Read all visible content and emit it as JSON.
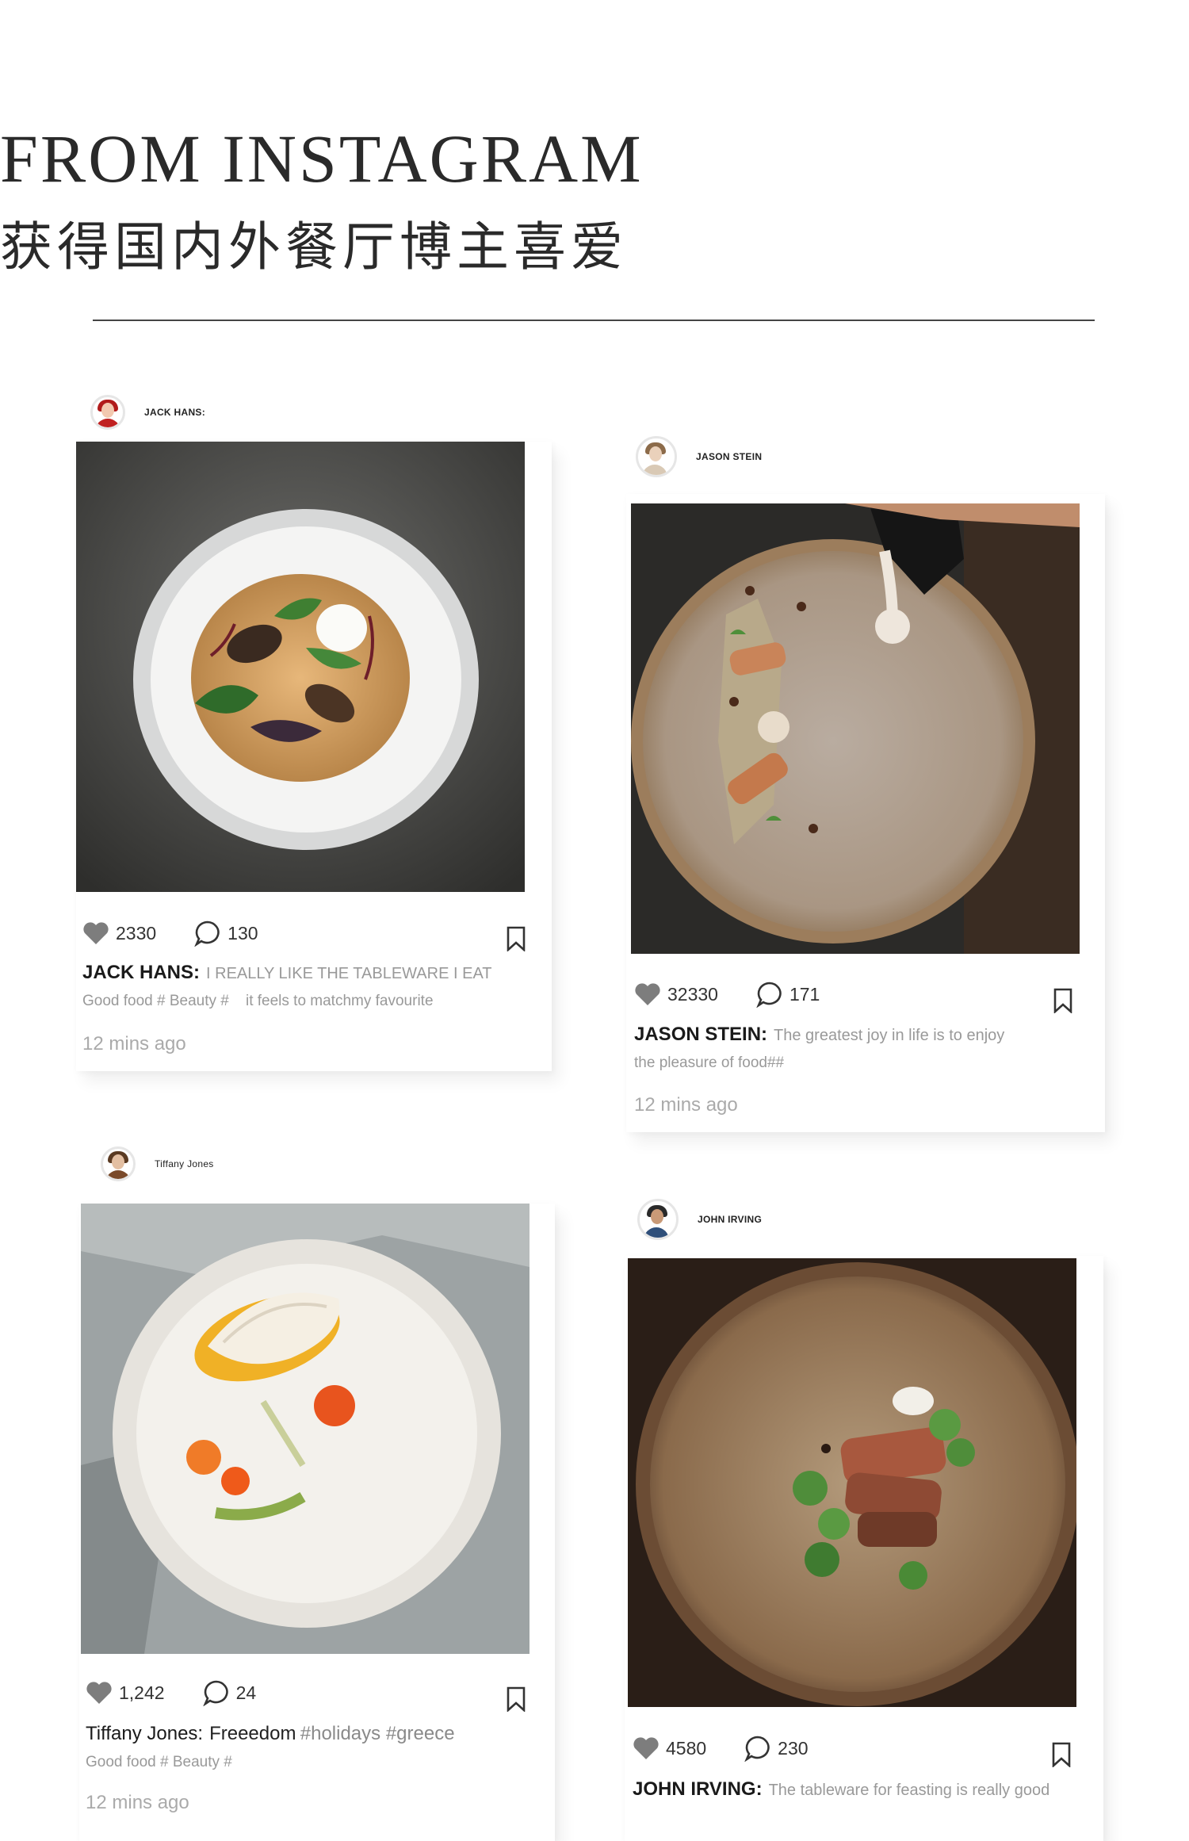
{
  "header": {
    "title_en": "FROM INSTAGRAM",
    "title_cn": "获得国内外餐厅博主喜爱"
  },
  "posts": [
    {
      "username": "JACK HANS:",
      "likes": "2330",
      "comments": "130",
      "caption_name": "JACK HANS:",
      "caption_text": "I REALLY LIKE THE TABLEWARE I EAT",
      "caption_line2": "Good food # Beauty #    it feels to matchmy favourite",
      "time": "12 mins ago"
    },
    {
      "username": "JASON STEIN",
      "likes": "32330",
      "comments": "171",
      "caption_name": "JASON STEIN:",
      "caption_text": "The greatest joy in life is to enjoy",
      "caption_line2": "the pleasure of food##",
      "time": "12 mins ago"
    },
    {
      "username": "Tiffany Jones",
      "likes": "1,242",
      "comments": "24",
      "caption_name": "Tiffany Jones:",
      "caption_text": "Freeedom",
      "caption_tags": "#holidays #greece",
      "caption_line2": "Good food # Beauty #",
      "time": "12 mins ago"
    },
    {
      "username": "JOHN IRVING",
      "likes": "4580",
      "comments": "230",
      "caption_name": "JOHN IRVING:",
      "caption_text": "The tableware for feasting is really good"
    }
  ],
  "icons": {
    "like": "heart-icon",
    "comment": "comment-bubble-icon",
    "save": "bookmark-icon"
  },
  "colors": {
    "icon_gray": "#7d7d7d",
    "text_dark": "#1a1a1a",
    "text_muted": "#999999"
  }
}
